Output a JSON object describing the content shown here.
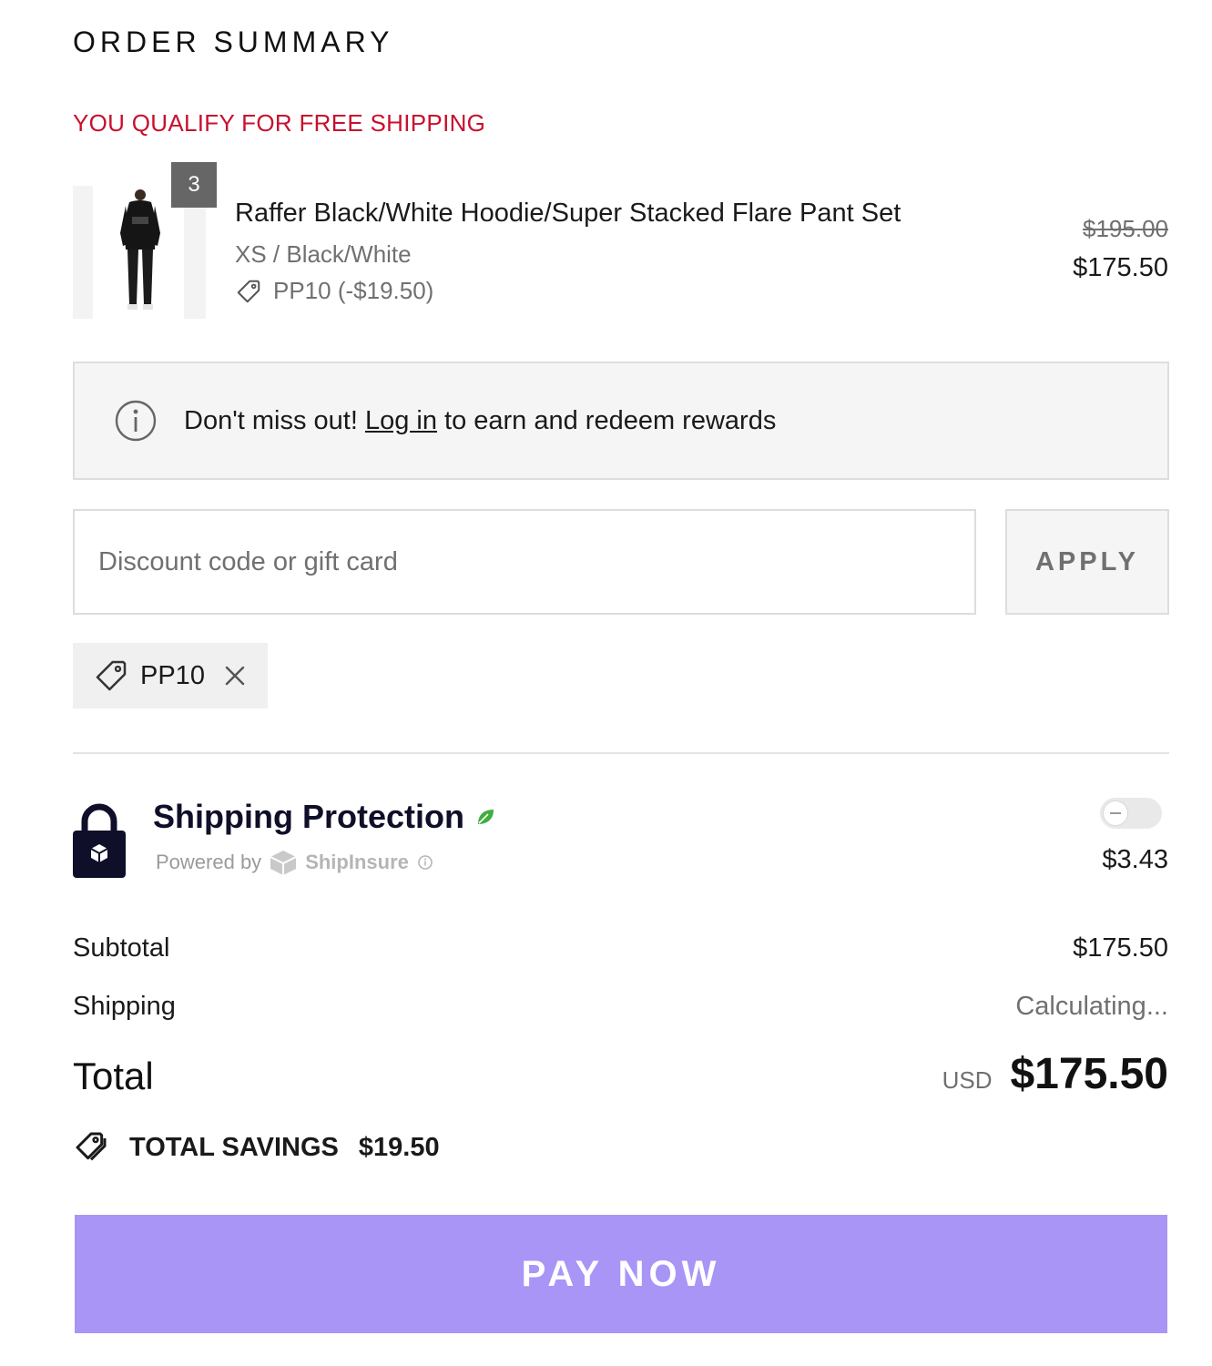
{
  "header": {
    "title": "ORDER SUMMARY",
    "free_shipping": "YOU QUALIFY FOR FREE SHIPPING"
  },
  "item": {
    "quantity": "3",
    "name": "Raffer Black/White Hoodie/Super Stacked Flare Pant Set",
    "variant": "XS / Black/White",
    "discount": "PP10 (-$19.50)",
    "original_price": "$195.00",
    "price": "$175.50"
  },
  "rewards_banner": {
    "prefix": "Don't miss out! ",
    "link": "Log in",
    "suffix": " to earn and redeem rewards"
  },
  "discount": {
    "placeholder": "Discount code or gift card",
    "apply_label": "APPLY",
    "applied_code": "PP10"
  },
  "shipping_protection": {
    "title": "Shipping Protection",
    "powered_by": "Powered by",
    "brand": "ShipInsure",
    "price": "$3.43",
    "enabled": false
  },
  "totals": {
    "subtotal_label": "Subtotal",
    "subtotal": "$175.50",
    "shipping_label": "Shipping",
    "shipping": "Calculating...",
    "total_label": "Total",
    "currency": "USD",
    "total": "$175.50",
    "savings_label": "TOTAL SAVINGS",
    "savings": "$19.50"
  },
  "pay_button": "PAY NOW",
  "colors": {
    "free_shipping": "#c8102e",
    "pay_button": "#a995f6",
    "leaf": "#3fae3f"
  }
}
